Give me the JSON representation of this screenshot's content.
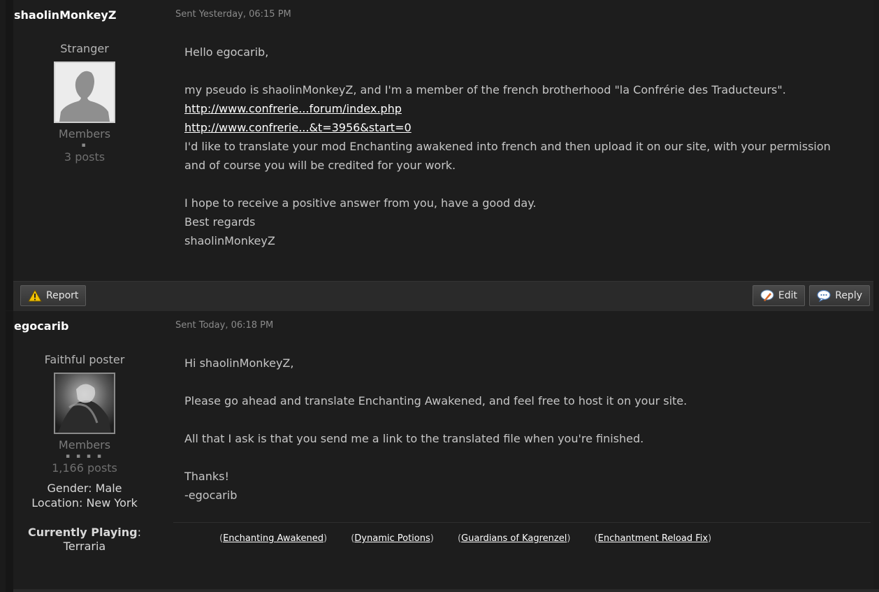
{
  "posts": [
    {
      "author": "shaolinMonkeyZ",
      "sent": "Sent Yesterday, 06:15 PM",
      "rank": "Stranger",
      "group": "Members",
      "pips": "▪",
      "post_count": "3 posts",
      "body": [
        "Hello egocarib,",
        "",
        "my pseudo is shaolinMonkeyZ, and I'm a member of the french brotherhood \"la Confrérie des Traducteurs\"."
      ],
      "links": [
        "http://www.confrerie...forum/index.php",
        "http://www.confrerie...&t=3956&start=0"
      ],
      "body2": [
        "I'd like to translate your mod Enchanting awakened into french and then upload it on our site, with your permission",
        "and of course you will be credited for your work.",
        "",
        "I hope to receive a positive answer from you, have a good day.",
        "Best regards",
        "shaolinMonkeyZ"
      ],
      "buttons": {
        "report": "Report",
        "edit": "Edit",
        "reply": "Reply"
      }
    },
    {
      "author": "egocarib",
      "sent": "Sent Today, 06:18 PM",
      "rank": "Faithful poster",
      "group": "Members",
      "pips": "▪ ▪ ▪ ▪",
      "post_count": "1,166 posts",
      "gender_label": "Gender:",
      "gender_value": "Male",
      "location_label": "Location:",
      "location_value": "New York",
      "playing_label": "Currently Playing",
      "playing_colon": ":",
      "playing_value": "Terraria",
      "body": [
        "Hi shaolinMonkeyZ,",
        "",
        "Please go ahead and translate Enchanting Awakened, and feel free to host it on your site.",
        "",
        "All that I ask is that you send me a link to the translated file when you're finished.",
        "",
        "Thanks!",
        "-egocarib"
      ],
      "signature": [
        "Enchanting Awakened",
        "Dynamic Potions",
        "Guardians of Kagrenzel",
        "Enchantment Reload Fix"
      ]
    }
  ],
  "colors": {
    "background": "#1b1b1b",
    "post_bg": "#1d1d1d",
    "link": "#ffffff",
    "toolbar": "#2a2a2a"
  }
}
